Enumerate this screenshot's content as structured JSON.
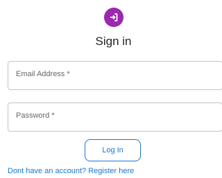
{
  "header": {
    "icon": "login-icon",
    "title": "Sign in"
  },
  "form": {
    "email_label": "Email Address *",
    "password_label": "Password *",
    "submit_label": "Log In",
    "register_link": "Dont have an account? Register here"
  },
  "colors": {
    "accent": "#9c27b0",
    "primary": "#1976d2",
    "border": "#c4c4c4"
  }
}
